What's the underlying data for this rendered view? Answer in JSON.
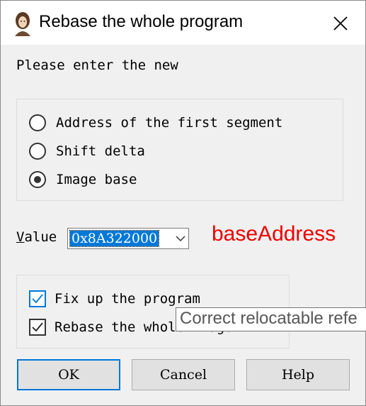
{
  "window": {
    "title": "Rebase the whole program",
    "icon": "portrait-icon"
  },
  "prompt": "Please enter the new",
  "radio_options": [
    {
      "label": "Address of the first segment",
      "checked": false
    },
    {
      "label": "Shift delta",
      "checked": false
    },
    {
      "label": "Image base",
      "checked": true
    }
  ],
  "value": {
    "label": "Value",
    "accel": "V",
    "label_rest": "alue",
    "input_value": "0x8A322000"
  },
  "annotation": {
    "text": "baseAddress",
    "color": "#ee0000"
  },
  "checkboxes": [
    {
      "label": "Fix up the program",
      "checked": true
    },
    {
      "label": "Rebase the whole image",
      "checked": true
    }
  ],
  "tooltip": "Correct relocatable refe",
  "buttons": {
    "ok": "OK",
    "cancel": "Cancel",
    "help": "Help"
  },
  "colors": {
    "accent": "#0078d7",
    "annotation": "#ee0000"
  }
}
